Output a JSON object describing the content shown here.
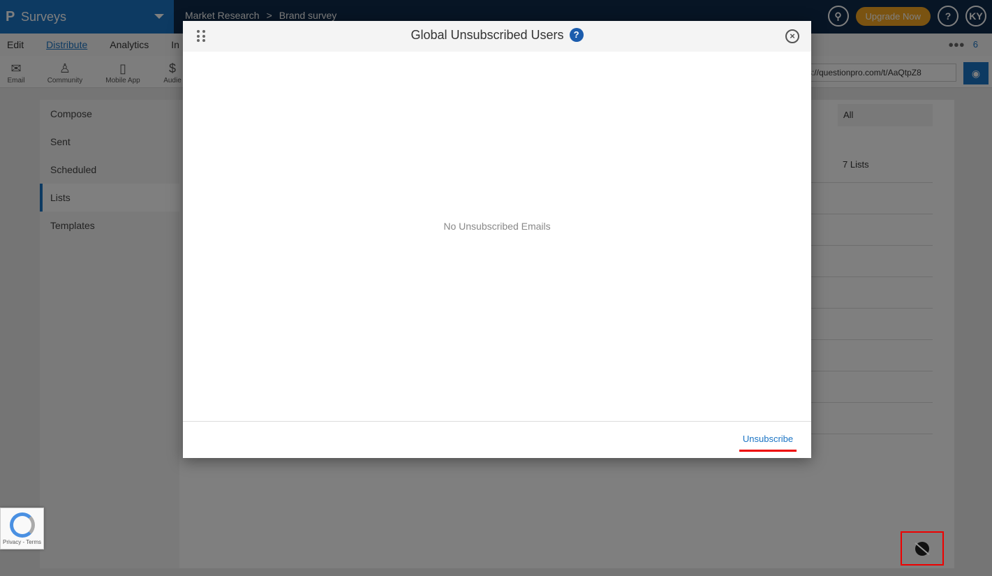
{
  "topbar": {
    "brand_logo": "P",
    "brand_name": "Surveys",
    "breadcrumb_1": "Market Research",
    "breadcrumb_sep": ">",
    "breadcrumb_2": "Brand survey",
    "upgrade_label": "Upgrade Now",
    "help_label": "?",
    "user_initials": "KY"
  },
  "menu": {
    "items": [
      "Edit",
      "Distribute",
      "Analytics",
      "In"
    ],
    "active": "Distribute",
    "team_count": "6"
  },
  "toolbar": {
    "tools": [
      "Email",
      "Community",
      "Mobile App",
      "Audie"
    ],
    "url_value": "s://questionpro.com/t/AaQtpZ8"
  },
  "leftnav": {
    "items": [
      "Compose",
      "Sent",
      "Scheduled",
      "Lists",
      "Templates"
    ],
    "active": "Lists"
  },
  "content": {
    "filter_value": "All",
    "lists_count": "7 Lists"
  },
  "modal": {
    "title": "Global Unsubscribed Users",
    "help_icon": "?",
    "close_icon": "×",
    "empty_message": "No Unsubscribed Emails",
    "unsubscribe_label": "Unsubscribe"
  },
  "recaptcha": {
    "text": "Privacy - Terms"
  },
  "colors": {
    "brand_blue": "#1b74c4",
    "topbar_navy": "#0f2a4a",
    "upgrade_orange": "#f5a623",
    "highlight_red": "#e00000"
  }
}
